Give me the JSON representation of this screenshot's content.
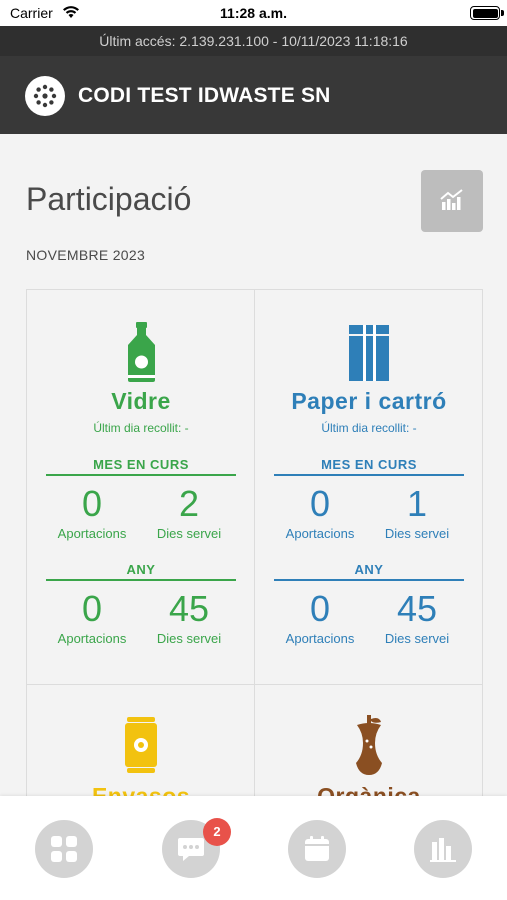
{
  "status_bar": {
    "carrier": "Carrier",
    "time": "11:28 a.m."
  },
  "last_access": "Últim accés: 2.139.231.100 - 10/11/2023 11:18:16",
  "header": {
    "title": "CODI TEST IDWASTE SN"
  },
  "page": {
    "title": "Participació",
    "period": "NOVEMBRE 2023"
  },
  "colors": {
    "vidre": "#3aa54a",
    "paper": "#2e7fb8",
    "envasos": "#f2c20f",
    "organica": "#8a4f22",
    "header": "#383838"
  },
  "cards": [
    {
      "name": "Vidre",
      "icon": "bottle-icon",
      "last_day": "Últim dia recollit: -",
      "month": {
        "label": "MES EN CURS",
        "aportacions": "0",
        "aportacions_label": "Aportacions",
        "dies": "2",
        "dies_label": "Dies servei"
      },
      "year": {
        "label": "ANY",
        "aportacions": "0",
        "aportacions_label": "Aportacions",
        "dies": "45",
        "dies_label": "Dies servei"
      }
    },
    {
      "name": "Paper i cartró",
      "icon": "paper-box-icon",
      "last_day": "Últim dia recollit: -",
      "month": {
        "label": "MES EN CURS",
        "aportacions": "0",
        "aportacions_label": "Aportacions",
        "dies": "1",
        "dies_label": "Dies servei"
      },
      "year": {
        "label": "ANY",
        "aportacions": "0",
        "aportacions_label": "Aportacions",
        "dies": "45",
        "dies_label": "Dies servei"
      }
    },
    {
      "name": "Envasos",
      "icon": "can-icon"
    },
    {
      "name": "Orgànica",
      "icon": "apple-core-icon"
    }
  ],
  "bottom_nav": {
    "items": [
      {
        "icon": "dashboard-grid-icon"
      },
      {
        "icon": "chat-bubble-icon",
        "badge": "2"
      },
      {
        "icon": "calendar-icon"
      },
      {
        "icon": "bar-chart-icon"
      }
    ]
  }
}
